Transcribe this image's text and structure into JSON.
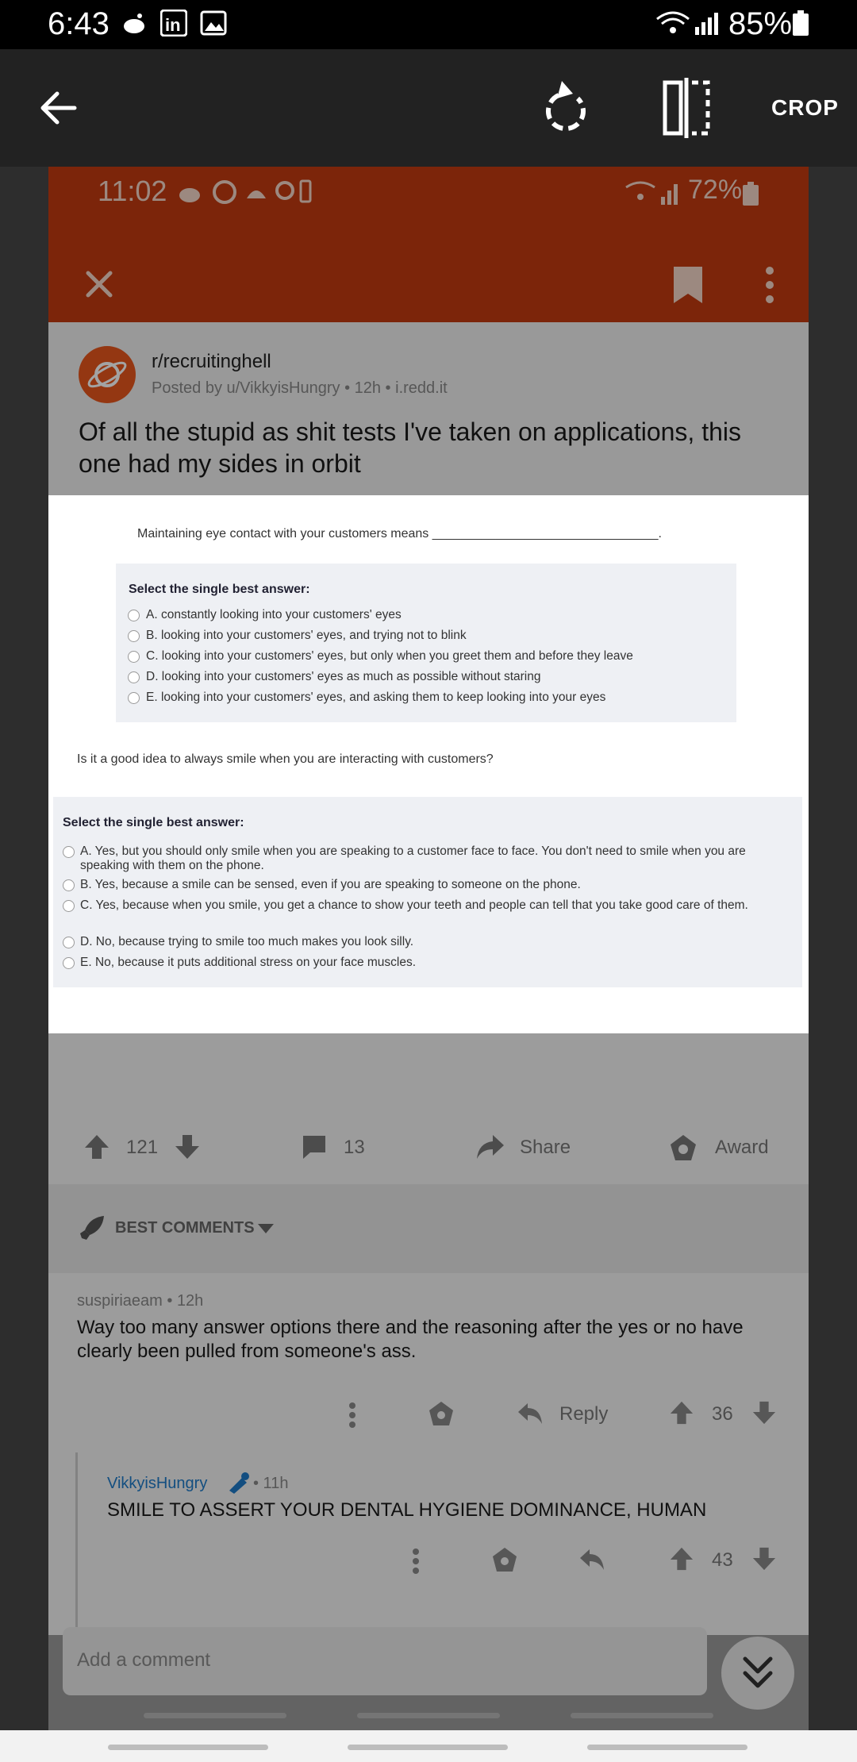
{
  "status_bar": {
    "time": "6:43",
    "battery": "85%"
  },
  "editor": {
    "crop_label": "CROP"
  },
  "screenshot": {
    "status_bar": {
      "time": "11:02",
      "battery": "72%"
    },
    "post": {
      "subreddit": "r/recruitinghell",
      "meta": "Posted by u/VikkyisHungry • 12h • i.redd.it",
      "title": "Of all the stupid as shit tests I've taken on applications, this one had my sides in orbit"
    },
    "quiz": {
      "q1": {
        "prompt": "Maintaining eye contact with your customers means ________________________________.",
        "select_label": "Select the single best answer:",
        "options": [
          "A. constantly looking into your customers' eyes",
          "B. looking into your customers' eyes, and trying not to blink",
          "C. looking into your customers' eyes, but only when you greet them and before they leave",
          "D. looking into your customers' eyes as much as possible without staring",
          "E. looking into your customers' eyes, and asking them to keep looking into your eyes"
        ]
      },
      "q2": {
        "prompt": "Is it a good idea to always smile when you are interacting with customers?",
        "select_label": "Select the single best answer:",
        "options": [
          "A. Yes, but you should only smile when you are speaking to a customer face to face. You don't need to smile when you are speaking with them on the phone.",
          "B. Yes, because a smile can be sensed, even if you are speaking to someone on the phone.",
          "C. Yes, because when you smile, you get a chance to show your teeth and people can tell that you take good care of them.",
          "D. No, because trying to smile too much makes you look silly.",
          "E. No, because it puts additional stress on your face muscles."
        ]
      }
    },
    "actions": {
      "votes": "121",
      "comments": "13",
      "share": "Share",
      "award": "Award"
    },
    "best_comments_label": "BEST COMMENTS",
    "comment1": {
      "meta": "suspiriaeam • 12h",
      "text": "Way too many answer options there and the reasoning after the yes or no have clearly been pulled from someone's ass.",
      "reply": "Reply",
      "votes": "36"
    },
    "comment2": {
      "author": "VikkyisHungry",
      "time": "• 11h",
      "text": "SMILE TO ASSERT YOUR DENTAL HYGIENE DOMINANCE, HUMAN",
      "votes": "43"
    },
    "add_comment_placeholder": "Add a comment"
  },
  "colors": {
    "reddit_orange": "#c23a10",
    "avatar_orange": "#e8561d",
    "link_blue": "#1e7ac8"
  }
}
